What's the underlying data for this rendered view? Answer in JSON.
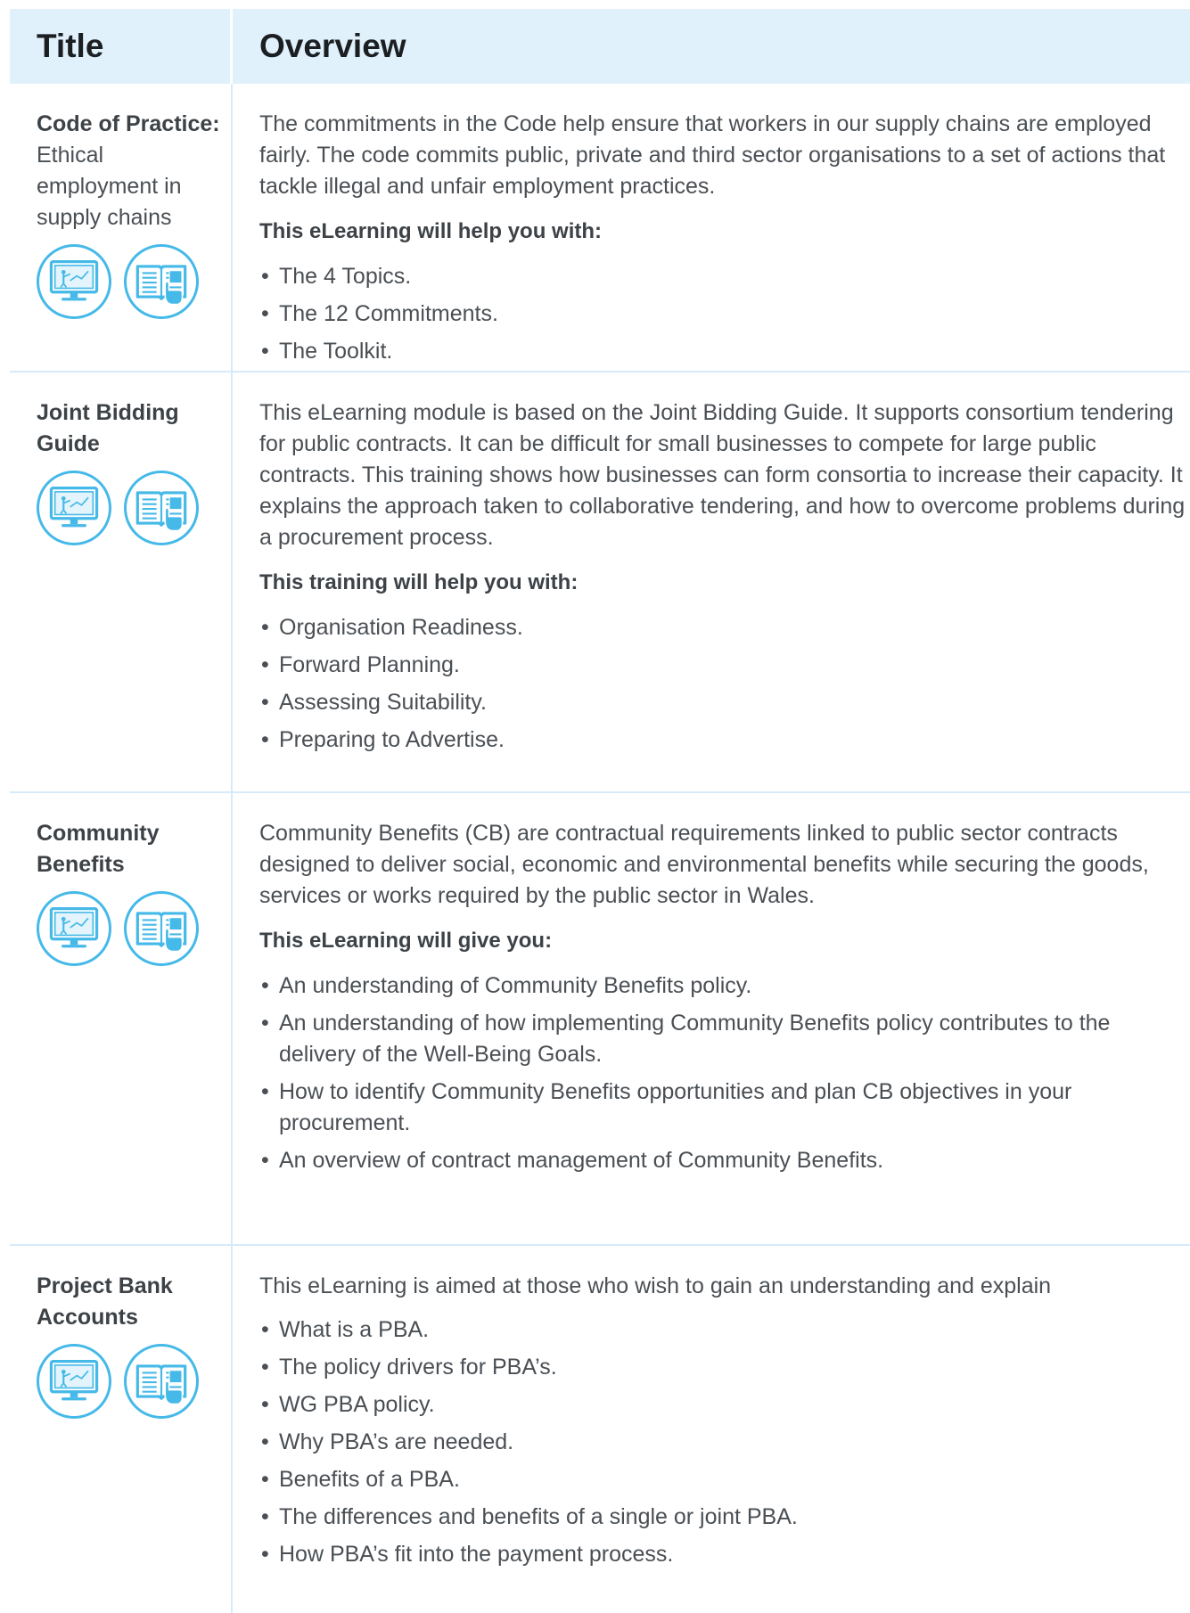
{
  "header": {
    "col1": "Title",
    "col2": "Overview"
  },
  "rows": [
    {
      "title_bold": "Code of Practice:",
      "title_regular": "Ethical employment in supply chains",
      "icons": [
        "presentation-screen-icon",
        "interactive-book-icon"
      ],
      "paragraph": "The commitments in the Code help ensure that workers in our supply chains are employed fairly. The code commits public, private and third sector organisations to a set of actions that tackle illegal and unfair employment practices.",
      "lead": "This eLearning will help you with:",
      "items": [
        "The 4 Topics.",
        "The 12 Commitments.",
        "The Toolkit."
      ]
    },
    {
      "title_bold": "Joint Bidding Guide",
      "title_regular": "",
      "icons": [
        "presentation-screen-icon",
        "interactive-book-icon"
      ],
      "paragraph": "This eLearning module is based on the Joint Bidding Guide. It supports consortium tendering for public contracts. It can be difficult for small businesses to compete for large public contracts. This training shows how businesses can form consortia to increase their capacity. It explains the approach taken to collaborative tendering, and how to overcome problems during a procurement process.",
      "lead": "This training will help you with:",
      "items": [
        "Organisation Readiness.",
        "Forward Planning.",
        "Assessing Suitability.",
        "Preparing to Advertise."
      ]
    },
    {
      "title_bold": "Community Benefits",
      "title_regular": "",
      "icons": [
        "presentation-screen-icon",
        "interactive-book-icon"
      ],
      "paragraph": "Community Benefits (CB) are contractual requirements linked to public sector contracts designed to deliver social, economic and environmental benefits while securing the goods, services or works required by the public sector in Wales.",
      "lead": "This eLearning will give you:",
      "items": [
        "An understanding of Community Benefits policy.",
        "An understanding of how implementing Community Benefits policy contributes to the delivery of the Well-Being Goals.",
        "How to identify Community Benefits opportunities and plan CB objectives in your procurement.",
        "An overview of contract management of Community Benefits."
      ]
    },
    {
      "title_bold": "Project Bank Accounts",
      "title_regular": "",
      "icons": [
        "presentation-screen-icon",
        "interactive-book-icon"
      ],
      "paragraph": "This eLearning is aimed at those who wish to gain an understanding and explain",
      "lead": "",
      "items": [
        "What is a PBA.",
        "The policy drivers for PBA’s.",
        "WG PBA policy.",
        "Why PBA’s are needed.",
        "Benefits of a PBA.",
        "The differences and benefits of a single or joint PBA.",
        "How PBA’s fit into the payment process."
      ]
    }
  ],
  "colors": {
    "accent": "#45b9e8",
    "header_bg": "#e1f1fc",
    "divider": "#d6ebfa"
  }
}
